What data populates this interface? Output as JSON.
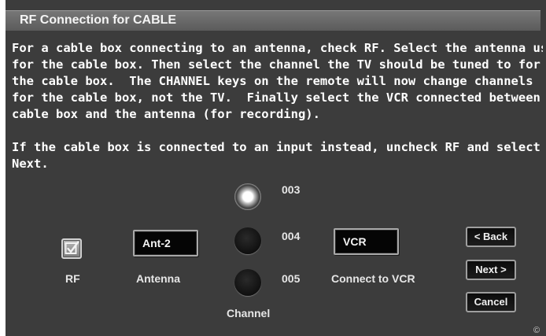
{
  "window": {
    "title": "RF Connection for CABLE"
  },
  "description": {
    "lines": [
      "For a cable box connecting to an antenna, check RF. Select the antenna used",
      "for the cable box. Then select the channel the TV should be tuned to for",
      "the cable box.  The CHANNEL keys on the remote will now change channels",
      "for the cable box, not the TV.  Finally select the VCR connected between the",
      "cable box and the antenna (for recording).",
      "",
      "If the cable box is connected to an input instead, uncheck RF and select",
      "Next."
    ]
  },
  "rf": {
    "label": "RF",
    "checked": true
  },
  "antenna": {
    "value": "Ant-2",
    "label": "Antenna"
  },
  "channel": {
    "label": "Channel",
    "options": [
      "003",
      "004",
      "005"
    ],
    "selected": "003"
  },
  "vcr": {
    "value": "VCR",
    "label": "Connect to VCR"
  },
  "buttons": {
    "back": "< Back",
    "next": "Next >",
    "cancel": "Cancel"
  },
  "copyright": "©",
  "colors": {
    "background": "#3c3c3c",
    "title_bar": "#6a6a6a",
    "text": "#ffffff",
    "field": "#050505"
  },
  "icons": {
    "rf_checkbox": "checkmark-icon"
  }
}
